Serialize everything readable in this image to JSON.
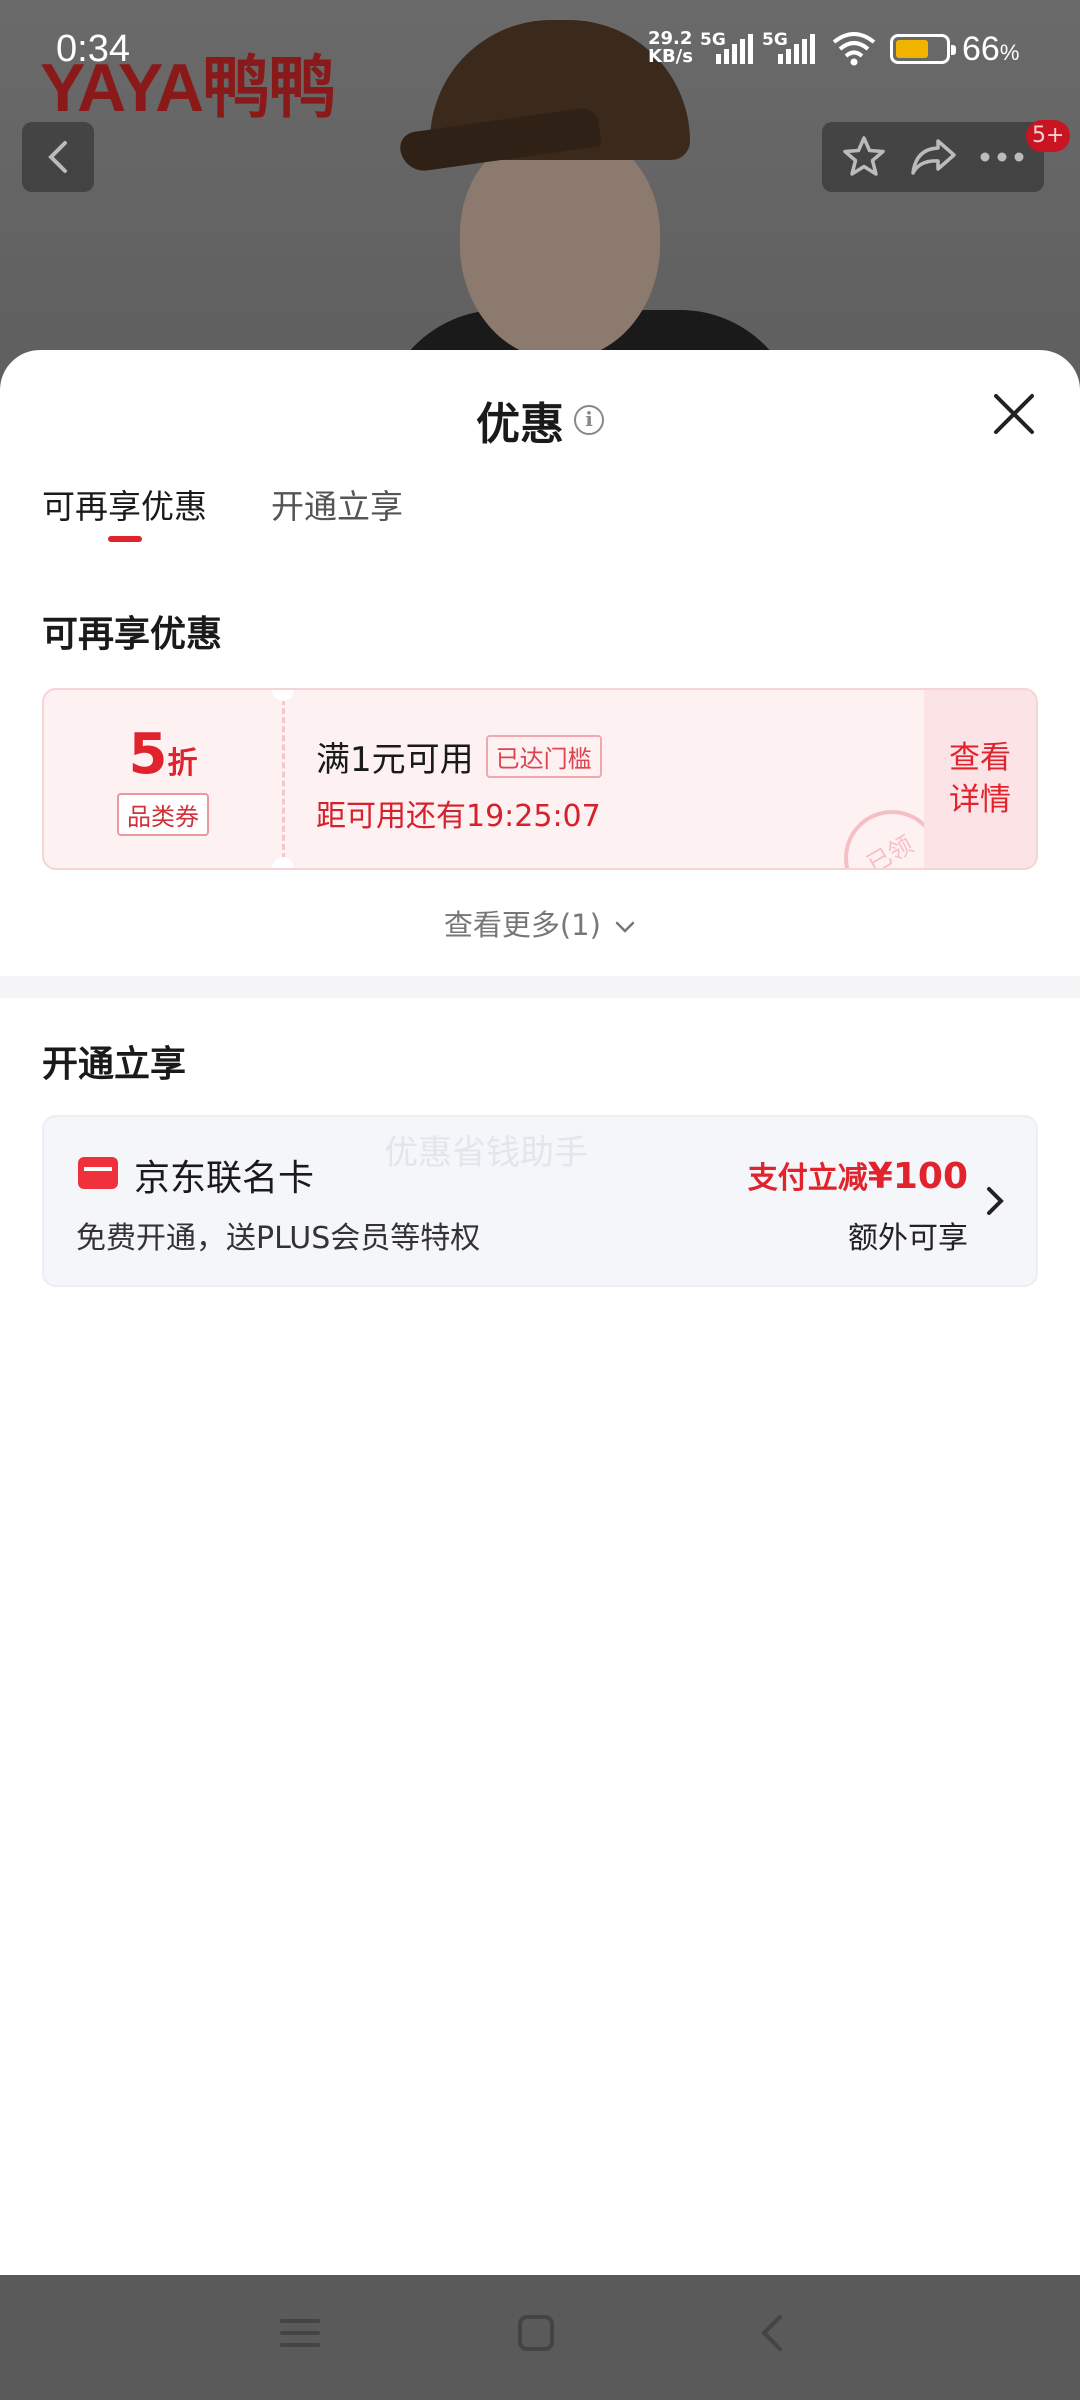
{
  "status_bar": {
    "time": "0:34",
    "net_speed_top": "29.2",
    "net_speed_bottom": "KB/s",
    "signal1_label": "5G",
    "signal2_label": "5G",
    "battery_pct": "66",
    "battery_unit": "%",
    "battery_level": 0.66
  },
  "background": {
    "brand": "YAYA鸭鸭",
    "notification_badge": "5+"
  },
  "sheet": {
    "title": "优惠",
    "tabs": [
      {
        "label": "可再享优惠",
        "active": true
      },
      {
        "label": "开通立享",
        "active": false
      }
    ],
    "section1": {
      "title": "可再享优惠",
      "coupon": {
        "discount_value": "5",
        "discount_unit": "折",
        "type": "品类券",
        "condition": "满1元可用",
        "threshold_tag": "已达门槛",
        "countdown": "距可用还有19:25:07",
        "action_line1": "查看",
        "action_line2": "详情",
        "stamp": "已领"
      },
      "more_label": "查看更多(1)"
    },
    "section2": {
      "title": "开通立享",
      "watermark": "优惠省钱助手",
      "card": {
        "name": "京东联名卡",
        "description": "免费开通，送PLUS会员等特权",
        "promo_prefix": "支付立减",
        "promo_amount": "¥100",
        "extra": "额外可享"
      }
    }
  },
  "colors": {
    "accent": "#e0232c",
    "coupon_bg": "#fdf1f2",
    "card_bg": "#f5f6fa"
  }
}
